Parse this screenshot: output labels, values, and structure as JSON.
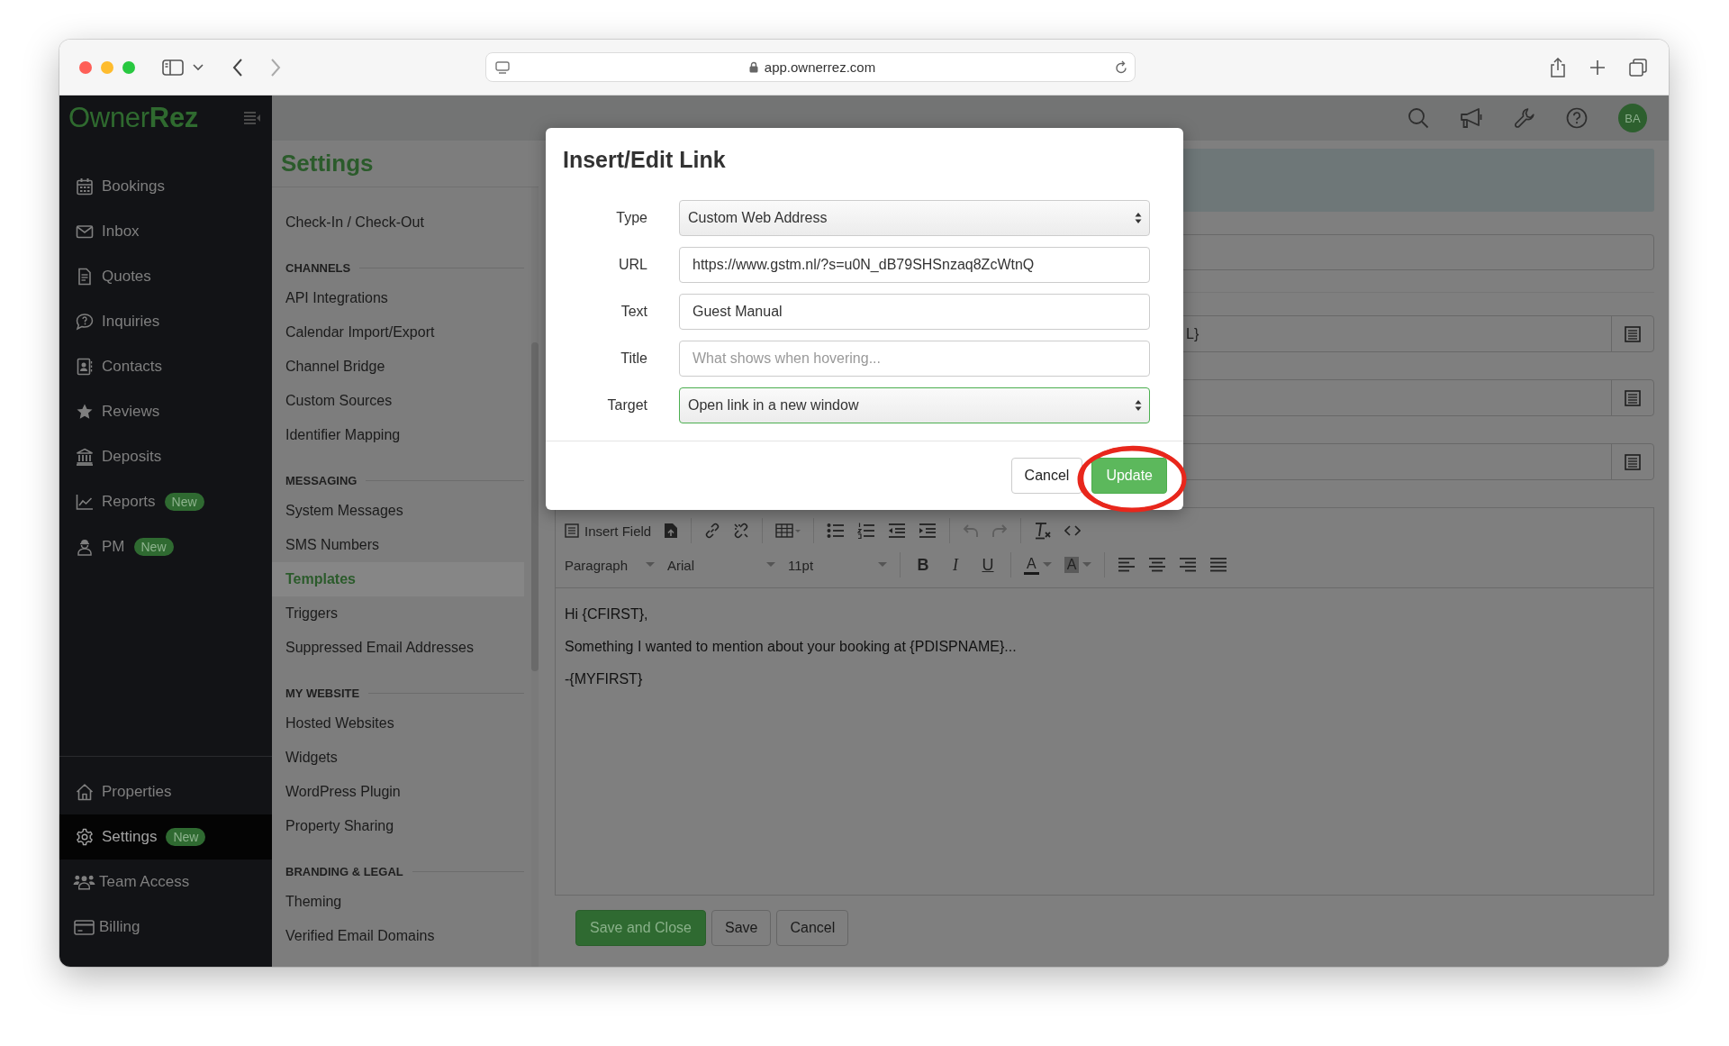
{
  "browser": {
    "address": "app.ownerrez.com"
  },
  "logo": {
    "light": "Owner",
    "bold": "Rez"
  },
  "topbar": {
    "avatar": "BA"
  },
  "sidebar": {
    "items": [
      {
        "label": "Bookings",
        "selected": false
      },
      {
        "label": "Inbox",
        "selected": false
      },
      {
        "label": "Quotes",
        "selected": false
      },
      {
        "label": "Inquiries",
        "selected": false
      },
      {
        "label": "Contacts",
        "selected": false
      },
      {
        "label": "Reviews",
        "selected": false
      },
      {
        "label": "Deposits",
        "selected": false
      },
      {
        "label": "Reports",
        "badge": "New",
        "selected": false
      },
      {
        "label": "PM",
        "badge": "New",
        "selected": false
      }
    ],
    "bottom_items": [
      {
        "label": "Properties",
        "selected": false
      },
      {
        "label": "Settings",
        "badge": "New",
        "selected": true
      },
      {
        "label": "Team Access",
        "selected": false
      },
      {
        "label": "Billing",
        "selected": false
      }
    ]
  },
  "settings_menu": {
    "title": "Settings",
    "sections": [
      {
        "items": [
          {
            "label": "Check-In / Check-Out",
            "selected": false
          }
        ]
      },
      {
        "heading": "CHANNELS",
        "items": [
          {
            "label": "API Integrations",
            "selected": false
          },
          {
            "label": "Calendar Import/Export",
            "selected": false
          },
          {
            "label": "Channel Bridge",
            "selected": false
          },
          {
            "label": "Custom Sources",
            "selected": false
          },
          {
            "label": "Identifier Mapping",
            "selected": false
          }
        ]
      },
      {
        "heading": "MESSAGING",
        "items": [
          {
            "label": "System Messages",
            "selected": false
          },
          {
            "label": "SMS Numbers",
            "selected": false
          },
          {
            "label": "Templates",
            "selected": true
          },
          {
            "label": "Triggers",
            "selected": false
          },
          {
            "label": "Suppressed Email Addresses",
            "selected": false
          }
        ]
      },
      {
        "heading": "MY WEBSITE",
        "items": [
          {
            "label": "Hosted Websites",
            "selected": false
          },
          {
            "label": "Widgets",
            "selected": false
          },
          {
            "label": "WordPress Plugin",
            "selected": false
          },
          {
            "label": "Property Sharing",
            "selected": false
          }
        ]
      },
      {
        "heading": "BRANDING & LEGAL",
        "items": [
          {
            "label": "Theming",
            "selected": false
          },
          {
            "label": "Verified Email Domains",
            "selected": false
          }
        ]
      }
    ]
  },
  "dialog": {
    "title": "Insert/Edit Link",
    "fields": [
      {
        "label": "Type",
        "kind": "select",
        "value": "Custom Web Address",
        "focused": false
      },
      {
        "label": "URL",
        "kind": "input",
        "value": "https://www.gstm.nl/?s=u0N_dB79SHSnzaq8ZcWtnQ",
        "focused": false
      },
      {
        "label": "Text",
        "kind": "input",
        "value": "Guest Manual",
        "focused": false
      },
      {
        "label": "Title",
        "kind": "input",
        "placeholder": "What shows when hovering...",
        "focused": false
      },
      {
        "label": "Target",
        "kind": "select",
        "value": "Open link in a new window",
        "focused": true
      }
    ],
    "buttons": [
      {
        "label": "Cancel",
        "kind": "secondary",
        "circled": false
      },
      {
        "label": "Update",
        "kind": "primary",
        "circled": true
      }
    ]
  },
  "form_behind": {
    "fragment": "L}"
  },
  "editor": {
    "insert_field": "Insert Field",
    "paragraph": "Paragraph",
    "font": "Arial",
    "size": "11pt",
    "format_buttons": [
      "B",
      "I",
      "U"
    ],
    "color_buttons": [
      "A",
      "A"
    ],
    "lines": [
      "Hi {CFIRST},",
      "Something I wanted to mention about your booking at {PDISPNAME}...",
      "-{MYFIRST}"
    ]
  },
  "actions": [
    {
      "label": "Save and Close",
      "kind": "primary"
    },
    {
      "label": "Save",
      "kind": "secondary"
    },
    {
      "label": "Cancel",
      "kind": "secondary"
    }
  ]
}
